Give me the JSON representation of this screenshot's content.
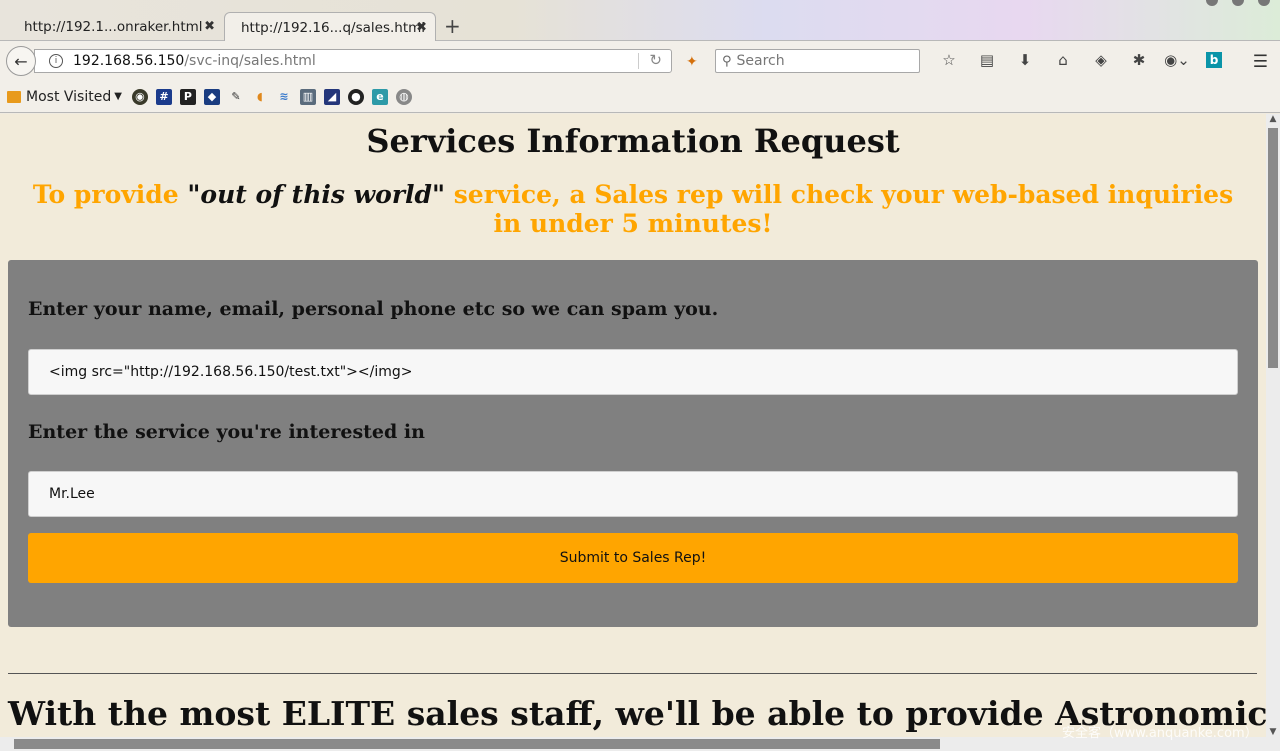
{
  "tabs": [
    {
      "label": "http://192.1...onraker.html",
      "close": "✖"
    },
    {
      "label": "http://192.16...q/sales.html",
      "close": "✖"
    }
  ],
  "new_tab": "+",
  "navbar": {
    "url_host": "192.168.56.150",
    "url_path": "/svc-inq/sales.html",
    "search_placeholder": "Search"
  },
  "bookmarks": {
    "most_visited": "Most Visited",
    "icons": [
      "fortune-icon",
      "hash-icon",
      "p-icon",
      "vpn-icon",
      "tool-icon",
      "fox-icon",
      "feather-icon",
      "book-icon",
      "chart-icon",
      "github-icon",
      "browser-icon",
      "globe-icon"
    ]
  },
  "page": {
    "title": "Services Information Request",
    "tagline_prefix": "To provide ",
    "tagline_quote_open": "\"",
    "tagline_emph": "out of this world",
    "tagline_quote_close": "\"",
    "tagline_suffix": " service, a Sales rep will check your web-based inquiries in under 5 minutes!",
    "form": {
      "label_contact": "Enter your name, email, personal phone etc so we can spam you.",
      "contact_value": "<img src=\"http://192.168.56.150/test.txt\"></img>",
      "label_service": "Enter the service you're interested in",
      "service_value": "Mr.Lee",
      "submit_label": "Submit to Sales Rep!"
    },
    "bottom_heading": "With the most ELITE sales staff, we'll be able to provide Astronomical"
  },
  "watermark": "安全客（www.anquanke.com）",
  "colors": {
    "accent": "#ffa500",
    "panel": "#808080",
    "page_bg": "#f2ebda"
  }
}
